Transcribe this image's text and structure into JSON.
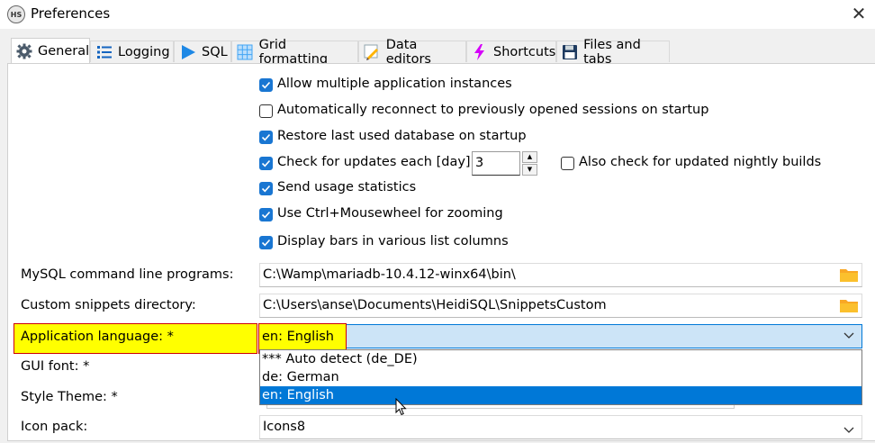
{
  "window": {
    "title": "Preferences",
    "app_icon_text": "HS",
    "close_glyph": "✕"
  },
  "tabs": [
    {
      "label": "General",
      "icon": "gear-icon",
      "active": true
    },
    {
      "label": "Logging",
      "icon": "list-icon"
    },
    {
      "label": "SQL",
      "icon": "play-icon"
    },
    {
      "label": "Grid formatting",
      "icon": "grid-icon"
    },
    {
      "label": "Data editors",
      "icon": "pencil-icon"
    },
    {
      "label": "Shortcuts",
      "icon": "lightning-icon"
    },
    {
      "label": "Files and tabs",
      "icon": "floppy-disk-icon"
    }
  ],
  "general": {
    "checkboxes": [
      {
        "label": "Allow multiple application instances",
        "checked": true
      },
      {
        "label": "Automatically reconnect to previously opened sessions on startup",
        "checked": false
      },
      {
        "label": "Restore last used database on startup",
        "checked": true
      },
      {
        "label": "Check for updates each [day]:",
        "checked": true
      },
      {
        "label": "Send usage statistics",
        "checked": true
      },
      {
        "label": "Use Ctrl+Mousewheel for zooming",
        "checked": true
      },
      {
        "label": "Display bars in various list columns",
        "checked": true
      }
    ],
    "update_days": "3",
    "nightly_builds": {
      "label": "Also check for updated nightly builds",
      "checked": false
    },
    "mysql_programs": {
      "label": "MySQL command line programs:",
      "value": "C:\\Wamp\\mariadb-10.4.12-winx64\\bin\\"
    },
    "snippets_dir": {
      "label": "Custom snippets directory:",
      "value": "C:\\Users\\anse\\Documents\\HeidiSQL\\SnippetsCustom"
    },
    "app_language": {
      "label": "Application language: *",
      "selected": "en: English",
      "options": [
        "*** Auto detect (de_DE)",
        "de: German",
        "en: English"
      ]
    },
    "gui_font": {
      "label": "GUI font: *"
    },
    "style_theme": {
      "label": "Style Theme: *"
    },
    "icon_pack": {
      "label": "Icon pack:",
      "value": "Icons8"
    }
  },
  "colors": {
    "accent": "#1976d2",
    "selection": "#0078d7",
    "highlight": "#ffff00",
    "highlight_border": "#cc0000"
  }
}
